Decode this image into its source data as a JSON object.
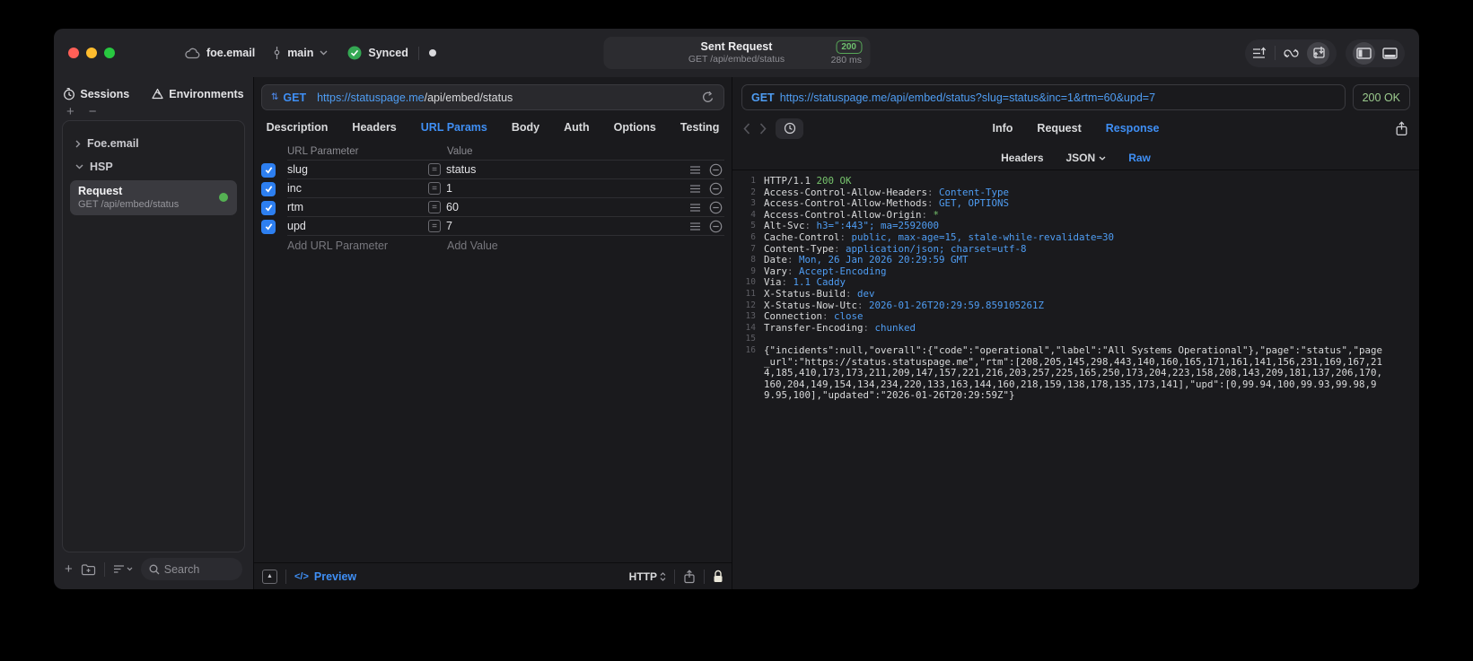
{
  "titlebar": {
    "project": "foe.email",
    "branch": "main",
    "sync_label": "Synced",
    "sent_request": {
      "title": "Sent Request",
      "subtitle": "GET /api/embed/status",
      "status_code": "200",
      "duration": "280 ms"
    }
  },
  "sidebar": {
    "tabs": [
      {
        "label": "Sessions"
      },
      {
        "label": "Environments"
      }
    ],
    "tree": [
      {
        "label": "Foe.email"
      },
      {
        "label": "HSP"
      }
    ],
    "request_item": {
      "title": "Request",
      "subtitle": "GET /api/embed/status"
    },
    "search_placeholder": "Search"
  },
  "request_editor": {
    "method": "GET",
    "url_host": "https://statuspage.me",
    "url_path": "/api/embed/status",
    "tabs": [
      "Description",
      "Headers",
      "URL Params",
      "Body",
      "Auth",
      "Options",
      "Testing"
    ],
    "active_tab": "URL Params",
    "params": {
      "header_name": "URL Parameter",
      "header_value": "Value",
      "rows": [
        {
          "name": "slug",
          "value": "status"
        },
        {
          "name": "inc",
          "value": "1"
        },
        {
          "name": "rtm",
          "value": "60"
        },
        {
          "name": "upd",
          "value": "7"
        }
      ],
      "add_name": "Add URL Parameter",
      "add_value": "Add Value"
    },
    "footer": {
      "preview": "Preview",
      "code_glyph": "</>",
      "protocol": "HTTP"
    }
  },
  "response_viewer": {
    "method": "GET",
    "url": "https://statuspage.me/api/embed/status?slug=status&inc=1&rtm=60&upd=7",
    "status": "200 OK",
    "tabs": [
      "Info",
      "Request",
      "Response"
    ],
    "active_tab": "Response",
    "subtabs": [
      {
        "label": "Headers",
        "menu": false
      },
      {
        "label": "JSON",
        "menu": true
      },
      {
        "label": "Raw",
        "menu": false
      }
    ],
    "active_subtab": "Raw",
    "code_lines": [
      {
        "n": "1",
        "seg": [
          [
            "HTTP/1.1 ",
            "w"
          ],
          [
            "200 OK",
            "g"
          ]
        ]
      },
      {
        "n": "2",
        "seg": [
          [
            "Access-Control-Allow-Headers",
            "w"
          ],
          [
            ": ",
            "d"
          ],
          [
            "Content-Type",
            "b"
          ]
        ]
      },
      {
        "n": "3",
        "seg": [
          [
            "Access-Control-Allow-Methods",
            "w"
          ],
          [
            ": ",
            "d"
          ],
          [
            "GET, OPTIONS",
            "b"
          ]
        ]
      },
      {
        "n": "4",
        "seg": [
          [
            "Access-Control-Allow-Origin",
            "w"
          ],
          [
            ": ",
            "d"
          ],
          [
            "*",
            "g"
          ]
        ]
      },
      {
        "n": "5",
        "seg": [
          [
            "Alt-Svc",
            "w"
          ],
          [
            ": ",
            "d"
          ],
          [
            "h3=\":443\"; ma=2592000",
            "b"
          ]
        ]
      },
      {
        "n": "6",
        "seg": [
          [
            "Cache-Control",
            "w"
          ],
          [
            ": ",
            "d"
          ],
          [
            "public, max-age=15, stale-while-revalidate=30",
            "b"
          ]
        ]
      },
      {
        "n": "7",
        "seg": [
          [
            "Content-Type",
            "w"
          ],
          [
            ": ",
            "d"
          ],
          [
            "application/json; charset=utf-8",
            "b"
          ]
        ]
      },
      {
        "n": "8",
        "seg": [
          [
            "Date",
            "w"
          ],
          [
            ": ",
            "d"
          ],
          [
            "Mon, 26 Jan 2026 20:29:59 GMT",
            "b"
          ]
        ]
      },
      {
        "n": "9",
        "seg": [
          [
            "Vary",
            "w"
          ],
          [
            ": ",
            "d"
          ],
          [
            "Accept-Encoding",
            "b"
          ]
        ]
      },
      {
        "n": "10",
        "seg": [
          [
            "Via",
            "w"
          ],
          [
            ": ",
            "d"
          ],
          [
            "1.1 Caddy",
            "b"
          ]
        ]
      },
      {
        "n": "11",
        "seg": [
          [
            "X-Status-Build",
            "w"
          ],
          [
            ": ",
            "d"
          ],
          [
            "dev",
            "b"
          ]
        ]
      },
      {
        "n": "12",
        "seg": [
          [
            "X-Status-Now-Utc",
            "w"
          ],
          [
            ": ",
            "d"
          ],
          [
            "2026-01-26T20:29:59.859105261Z",
            "b"
          ]
        ]
      },
      {
        "n": "13",
        "seg": [
          [
            "Connection",
            "w"
          ],
          [
            ": ",
            "d"
          ],
          [
            "close",
            "b"
          ]
        ]
      },
      {
        "n": "14",
        "seg": [
          [
            "Transfer-Encoding",
            "w"
          ],
          [
            ": ",
            "d"
          ],
          [
            "chunked",
            "b"
          ]
        ]
      },
      {
        "n": "15",
        "seg": []
      },
      {
        "n": "16",
        "seg": [
          [
            "{\"incidents\":null,\"overall\":{\"code\":\"operational\",\"label\":\"All Systems Operational\"},\"page\":\"status\",\"page_url\":\"https://status.statuspage.me\",\"rtm\":[208,205,145,298,443,140,160,165,171,161,141,156,231,169,167,214,185,410,173,173,211,209,147,157,221,216,203,257,225,165,250,173,204,223,158,208,143,209,181,137,206,170,160,204,149,154,134,234,220,133,163,144,160,218,159,138,178,135,173,141],\"upd\":[0,99.94,100,99.93,99.98,99.95,100],\"updated\":\"2026-01-26T20:29:59Z\"}",
            "w"
          ]
        ]
      }
    ]
  },
  "colors": {
    "accent_blue": "#3f8ff5",
    "status_green": "#6fc06f",
    "checkbox_blue": "#2d7ff0",
    "request_dot_green": "#55b153"
  }
}
